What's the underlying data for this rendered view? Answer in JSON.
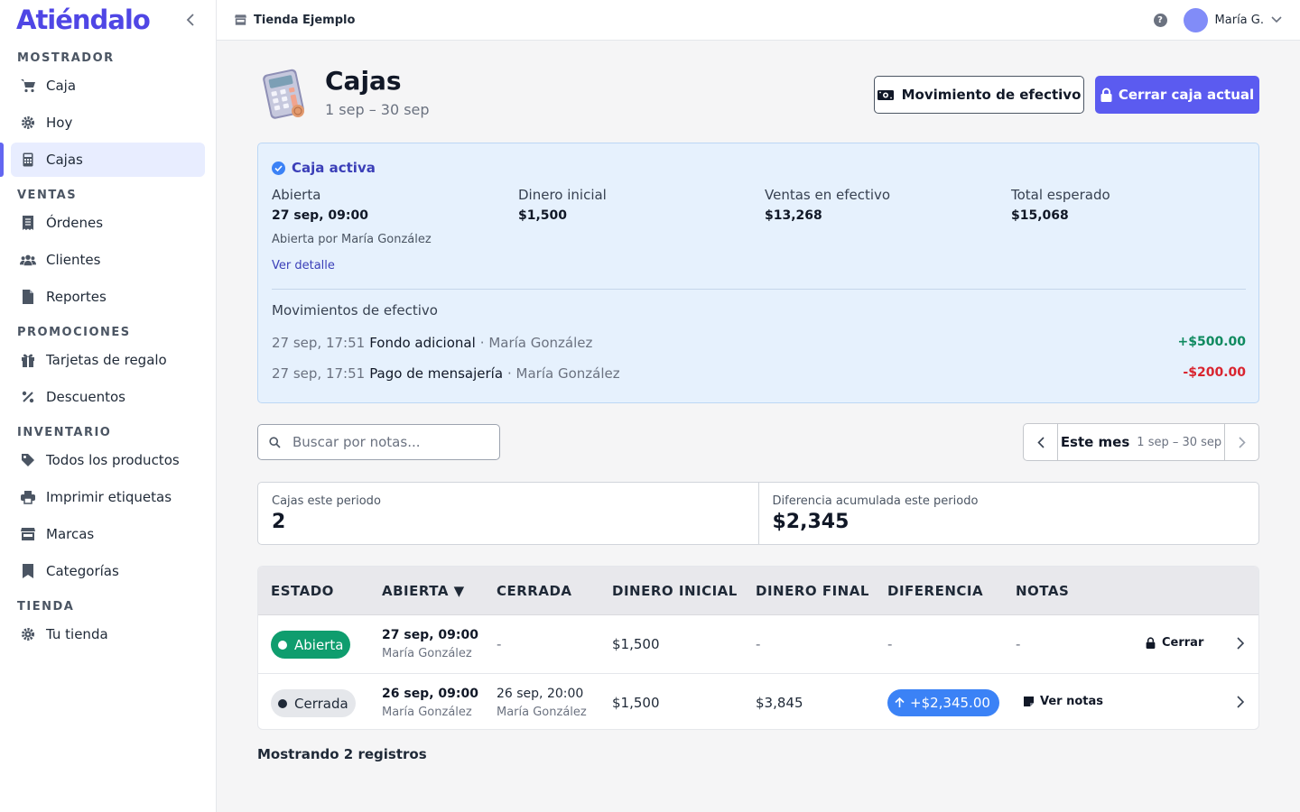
{
  "app": {
    "logo": "Atiéndalo"
  },
  "sidebar": {
    "sections": [
      {
        "title": "MOSTRADOR",
        "items": [
          {
            "label": "Caja",
            "icon": "cart-icon"
          },
          {
            "label": "Hoy",
            "icon": "gear-icon"
          },
          {
            "label": "Cajas",
            "icon": "calculator-icon",
            "active": true
          }
        ]
      },
      {
        "title": "VENTAS",
        "items": [
          {
            "label": "Órdenes",
            "icon": "receipt-icon"
          },
          {
            "label": "Clientes",
            "icon": "users-icon"
          },
          {
            "label": "Reportes",
            "icon": "document-icon"
          }
        ]
      },
      {
        "title": "PROMOCIONES",
        "items": [
          {
            "label": "Tarjetas de regalo",
            "icon": "gift-icon"
          },
          {
            "label": "Descuentos",
            "icon": "percent-icon"
          }
        ]
      },
      {
        "title": "INVENTARIO",
        "items": [
          {
            "label": "Todos los productos",
            "icon": "tag-icon"
          },
          {
            "label": "Imprimir etiquetas",
            "icon": "printer-icon"
          },
          {
            "label": "Marcas",
            "icon": "storefront-icon"
          },
          {
            "label": "Categorías",
            "icon": "bookmark-icon"
          }
        ]
      },
      {
        "title": "TIENDA",
        "items": [
          {
            "label": "Tu tienda",
            "icon": "gear-icon"
          }
        ]
      }
    ]
  },
  "topbar": {
    "store": "Tienda Ejemplo",
    "help": "?",
    "user": "María G."
  },
  "header": {
    "title": "Cajas",
    "subtitle": "1 sep – 30 sep",
    "btn_cash_movement": "Movimiento de efectivo",
    "btn_close_register": "Cerrar caja actual"
  },
  "active_register": {
    "title": "Caja activa",
    "fields": [
      {
        "label": "Abierta",
        "value": "27 sep, 09:00"
      },
      {
        "label": "Dinero inicial",
        "value": "$1,500"
      },
      {
        "label": "Ventas en efectivo",
        "value": "$13,268"
      },
      {
        "label": "Total esperado",
        "value": "$15,068"
      }
    ],
    "opened_by": "Abierta por María González",
    "detail_link": "Ver detalle",
    "movements_title": "Movimientos de efectivo",
    "movements": [
      {
        "time": "27 sep, 17:51",
        "desc": "Fondo adicional",
        "user": "· María González",
        "amount": "+$500.00",
        "kind": "pos"
      },
      {
        "time": "27 sep, 17:51",
        "desc": "Pago de mensajería",
        "user": "· María González",
        "amount": "-$200.00",
        "kind": "neg"
      }
    ]
  },
  "search": {
    "placeholder": "Buscar por notas..."
  },
  "period": {
    "label": "Este mes",
    "range": "1 sep – 30 sep"
  },
  "stats": [
    {
      "label": "Cajas este periodo",
      "value": "2"
    },
    {
      "label": "Diferencia acumulada este periodo",
      "value": "$2,345"
    }
  ],
  "table": {
    "headers": [
      "ESTADO",
      "ABIERTA ▼",
      "CERRADA",
      "DINERO INICIAL",
      "DINERO FINAL",
      "DIFERENCIA",
      "NOTAS"
    ],
    "rows": [
      {
        "status": "Abierta",
        "opened": "27 sep, 09:00",
        "opened_by": "María González",
        "closed": "-",
        "initial": "$1,500",
        "final": "-",
        "diff": "-",
        "notes": "-",
        "action": "Cerrar"
      },
      {
        "status": "Cerrada",
        "opened": "26 sep, 09:00",
        "opened_by": "María González",
        "closed": "26 sep, 20:00",
        "closed_by": "María González",
        "initial": "$1,500",
        "final": "$3,845",
        "diff": "+$2,345.00",
        "notes": "Ver notas"
      }
    ]
  },
  "footer": {
    "count": "Mostrando 2 registros"
  },
  "colors": {
    "brand": "#4f46e5",
    "primary": "#5b5bf0",
    "success": "#0f9d6e",
    "danger": "#d9242f",
    "info": "#3b82f6"
  }
}
